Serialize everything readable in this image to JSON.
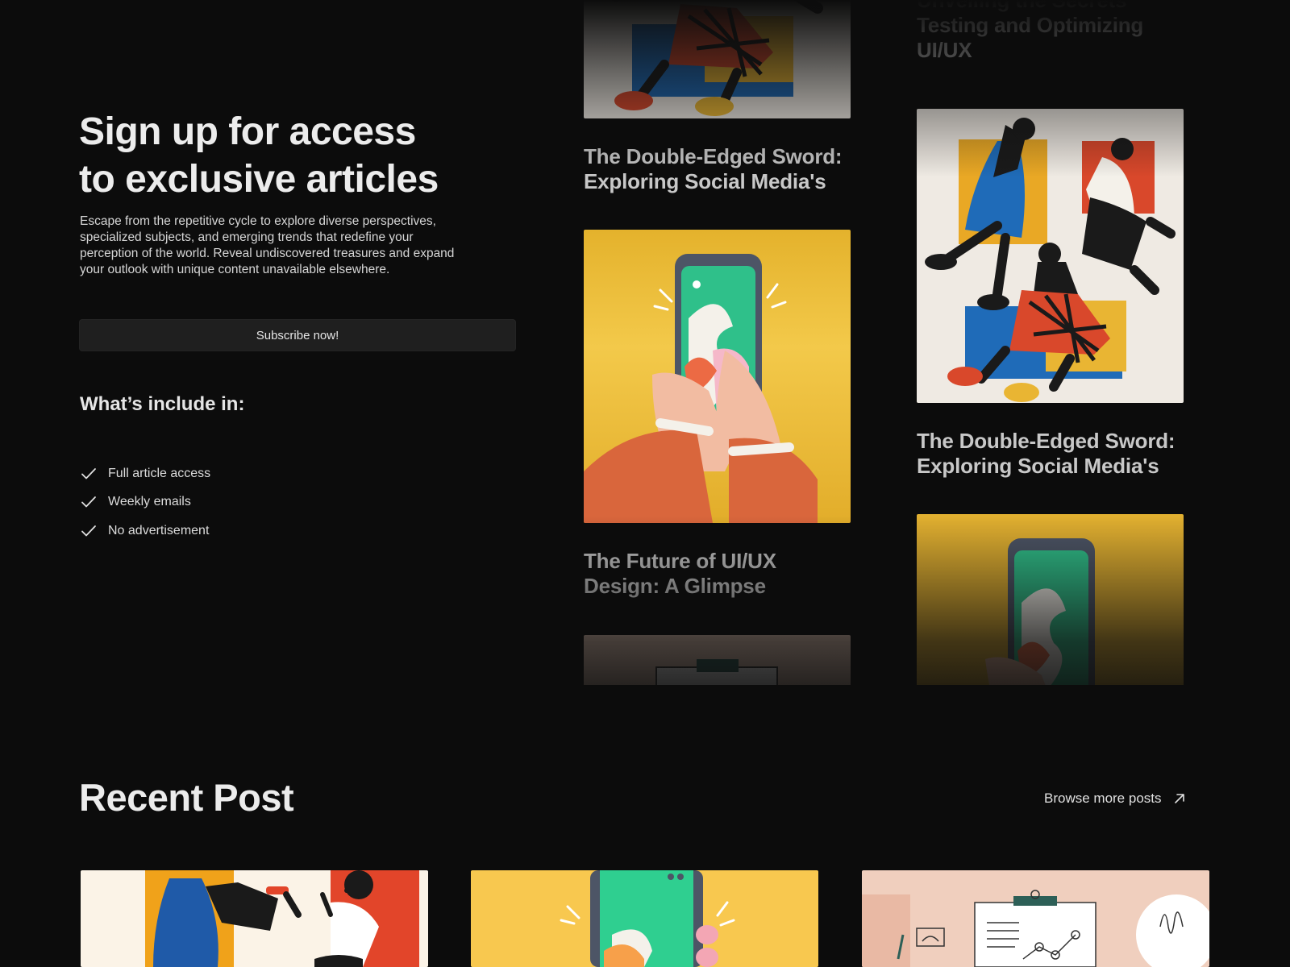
{
  "signup": {
    "title_line1": "Sign up for access",
    "title_line2": "to exclusive articles",
    "description": "Escape from the repetitive cycle to explore diverse perspectives, specialized subjects, and emerging trends that redefine your perception of the world. Reveal undiscovered treasures and expand your outlook with unique content unavailable elsewhere.",
    "subscribe_label": "Subscribe now!",
    "include_title": "What’s include in:",
    "features": [
      "Full article access",
      "Weekly emails",
      "No advertisement"
    ]
  },
  "articles": {
    "col1": [
      "The Double-Edged Sword: Exploring Social Media's",
      "The Future of UI/UX Design: A Glimpse"
    ],
    "col2": [
      "Unveiling the Secrets Testing and Optimizing UI/UX",
      "The Double-Edged Sword: Exploring Social Media's"
    ]
  },
  "recent": {
    "title": "Recent Post",
    "browse_label": "Browse more posts"
  },
  "icons": [
    "check-icon",
    "arrow-up-right-icon"
  ],
  "colors": {
    "background": "#0c0c0c",
    "button": "#1f1f1f",
    "yellow": "#e9b533",
    "blue": "#1f6bb8",
    "red": "#d9482b"
  }
}
